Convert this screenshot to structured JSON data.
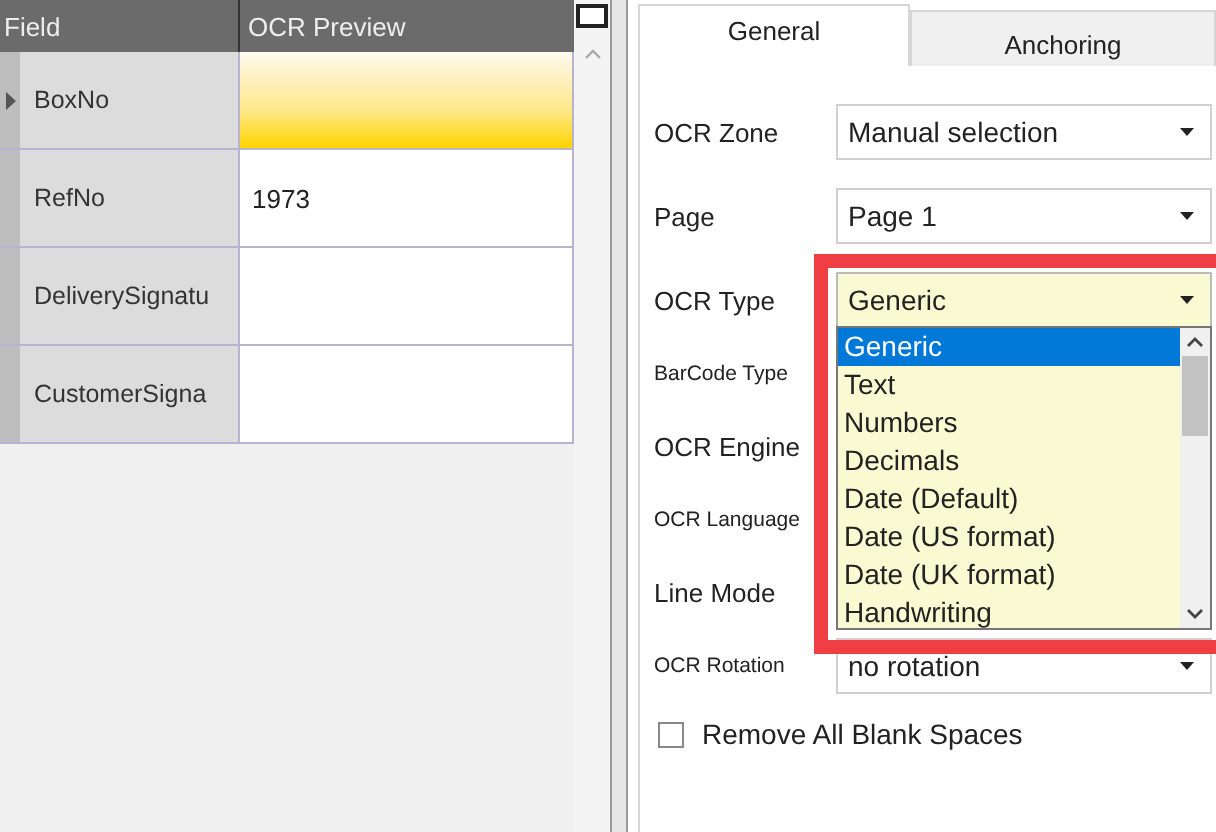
{
  "grid": {
    "columns": [
      "Field",
      "OCR Preview"
    ],
    "rows": [
      {
        "field": "BoxNo",
        "preview": "",
        "selected": true
      },
      {
        "field": "RefNo",
        "preview": "1973",
        "selected": false
      },
      {
        "field": "DeliverySignatu",
        "preview": "",
        "selected": false
      },
      {
        "field": "CustomerSigna",
        "preview": "",
        "selected": false
      }
    ]
  },
  "tabs": [
    {
      "label": "General",
      "selected": true
    },
    {
      "label": "Anchoring",
      "selected": false
    }
  ],
  "fields": [
    {
      "label": "OCR Zone",
      "kind": "combo",
      "minor": false,
      "value": "Manual selection"
    },
    {
      "label": "Page",
      "kind": "combo",
      "minor": false,
      "value": "Page 1"
    },
    {
      "label": "OCR Type",
      "kind": "combo",
      "minor": false,
      "value": "Generic",
      "expanded": true,
      "highlighted": true,
      "options": [
        {
          "label": "Generic",
          "selected": true
        },
        {
          "label": "Text",
          "selected": false
        },
        {
          "label": "Numbers",
          "selected": false
        },
        {
          "label": "Decimals",
          "selected": false
        },
        {
          "label": "Date (Default)",
          "selected": false
        },
        {
          "label": "Date (US format)",
          "selected": false
        },
        {
          "label": "Date (UK format)",
          "selected": false
        },
        {
          "label": "Handwriting",
          "selected": false
        }
      ]
    },
    {
      "label": "BarCode Type",
      "kind": "label",
      "minor": true
    },
    {
      "label": "OCR Engine",
      "kind": "label",
      "minor": false
    },
    {
      "label": "OCR Language",
      "kind": "label",
      "minor": true
    },
    {
      "label": "Line Mode",
      "kind": "label",
      "minor": false
    },
    {
      "label": "OCR Rotation",
      "kind": "combo",
      "minor": true,
      "value": "no rotation"
    }
  ],
  "checkbox": {
    "label": "Remove All Blank Spaces",
    "checked": false
  }
}
